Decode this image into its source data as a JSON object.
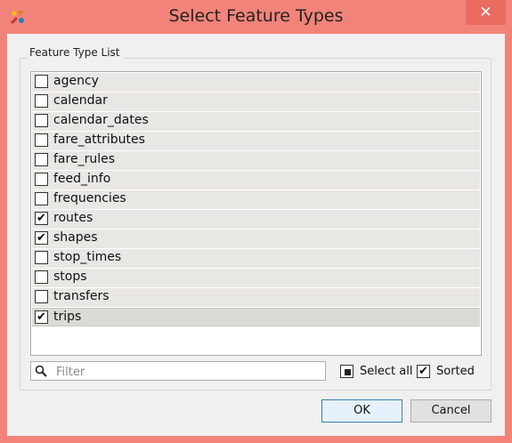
{
  "window": {
    "title": "Select Feature Types",
    "close_glyph": "✕"
  },
  "group": {
    "label": "Feature Type List"
  },
  "feature_types": [
    {
      "label": "agency",
      "checked": false
    },
    {
      "label": "calendar",
      "checked": false
    },
    {
      "label": "calendar_dates",
      "checked": false
    },
    {
      "label": "fare_attributes",
      "checked": false
    },
    {
      "label": "fare_rules",
      "checked": false
    },
    {
      "label": "feed_info",
      "checked": false
    },
    {
      "label": "frequencies",
      "checked": false
    },
    {
      "label": "routes",
      "checked": true
    },
    {
      "label": "shapes",
      "checked": true
    },
    {
      "label": "stop_times",
      "checked": false
    },
    {
      "label": "stops",
      "checked": false
    },
    {
      "label": "transfers",
      "checked": false
    },
    {
      "label": "trips",
      "checked": true,
      "selected": true
    }
  ],
  "filter": {
    "placeholder": "Filter",
    "value": ""
  },
  "options": {
    "select_all_label": "Select all",
    "select_all_state": "indeterminate",
    "sorted_label": "Sorted",
    "sorted_checked": true
  },
  "buttons": {
    "ok_label": "OK",
    "cancel_label": "Cancel"
  },
  "colors": {
    "titlebar": "#f2837a",
    "close_button": "#ea6b5f",
    "list_row": "#e9e7e3"
  }
}
